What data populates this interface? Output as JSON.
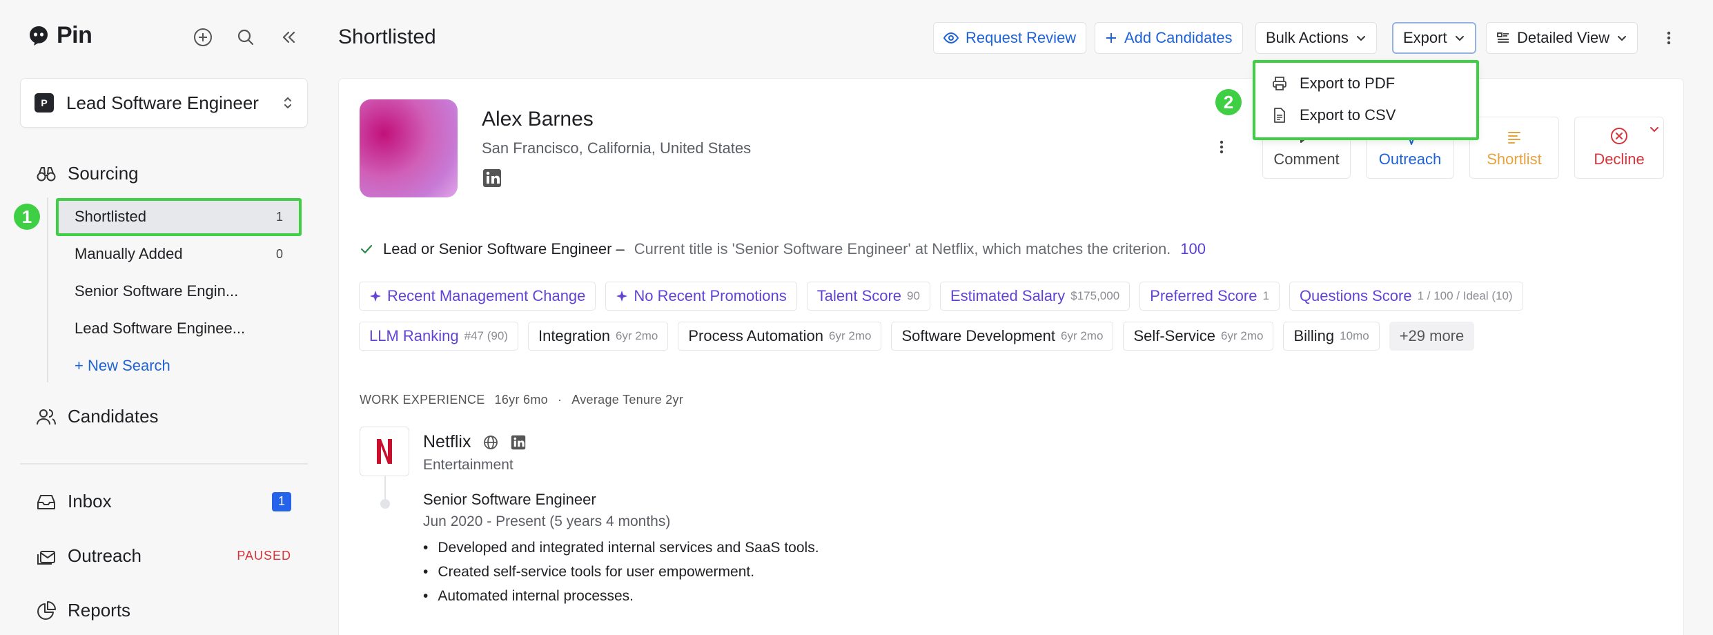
{
  "app": {
    "brand": "Pin"
  },
  "sidebar": {
    "job": {
      "badge": "P",
      "title": "Lead Software Engineer"
    },
    "sourcing": {
      "label": "Sourcing"
    },
    "searches": [
      {
        "label": "Shortlisted",
        "count": "1"
      },
      {
        "label": "Manually Added",
        "count": "0"
      },
      {
        "label": "Senior Software Engin...",
        "count": ""
      },
      {
        "label": "Lead Software Enginee...",
        "count": ""
      }
    ],
    "new_search": "+ New Search",
    "candidates": "Candidates",
    "inbox": {
      "label": "Inbox",
      "count": "1"
    },
    "outreach": {
      "label": "Outreach",
      "status": "PAUSED"
    },
    "reports": "Reports"
  },
  "annotations": {
    "first": "1",
    "second": "2"
  },
  "header": {
    "title": "Shortlisted",
    "request_review": "Request Review",
    "add_candidates": "Add Candidates",
    "bulk_actions": "Bulk Actions",
    "export": "Export",
    "view": "Detailed View"
  },
  "export_menu": {
    "items": [
      "Export to PDF",
      "Export to CSV"
    ]
  },
  "candidate": {
    "name": "Alex Barnes",
    "location": "San Francisco, California, United States",
    "actions": [
      "Comment",
      "Outreach",
      "Shortlist",
      "Decline"
    ],
    "criterion": {
      "title": "Lead or Senior Software Engineer –",
      "explanation": "Current title is 'Senior Software Engineer' at Netflix, which matches the criterion.",
      "score": "100"
    },
    "tags_row1": [
      {
        "label": "Recent Management Change",
        "sub": ""
      },
      {
        "label": "No Recent Promotions",
        "sub": ""
      },
      {
        "label": "Talent Score",
        "sub": "90"
      },
      {
        "label": "Estimated Salary",
        "sub": "$175,000"
      },
      {
        "label": "Preferred Score",
        "sub": "1"
      },
      {
        "label": "Questions Score",
        "sub": "1 / 100 / Ideal (10)"
      }
    ],
    "tags_row2": [
      {
        "label": "LLM Ranking",
        "sub": "#47 (90)"
      },
      {
        "label": "Integration",
        "sub": "6yr 2mo"
      },
      {
        "label": "Process Automation",
        "sub": "6yr 2mo"
      },
      {
        "label": "Software Development",
        "sub": "6yr 2mo"
      },
      {
        "label": "Self-Service",
        "sub": "6yr 2mo"
      },
      {
        "label": "Billing",
        "sub": "10mo"
      }
    ],
    "more_tags": "+29 more",
    "work_experience": {
      "heading": "WORK EXPERIENCE",
      "total": "16yr 6mo",
      "sep": "·",
      "avg": "Average Tenure 2yr",
      "company": "Netflix",
      "industry": "Entertainment",
      "role": "Senior Software Engineer",
      "dates": "Jun 2020 - Present (5 years 4 months)",
      "bullets": [
        "Developed and integrated internal services and SaaS tools.",
        "Created self-service tools for user empowerment.",
        "Automated internal processes."
      ]
    }
  },
  "colors": {
    "highlight": "#3fcf45",
    "link_blue": "#1e63d6",
    "shortlist_orange": "#e6a23c",
    "decline_red": "#d6343a",
    "tag_purple": "#6243d4"
  }
}
